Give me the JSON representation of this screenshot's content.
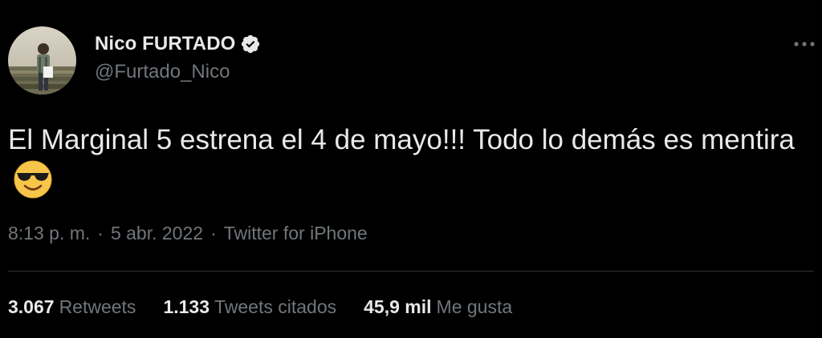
{
  "author": {
    "display_name": "Nico FURTADO",
    "handle": "@Furtado_Nico",
    "verified_icon": "verified-badge-icon",
    "avatar_icon": "profile-photo"
  },
  "menu": {
    "icon": "more-horizontal-icon"
  },
  "tweet": {
    "text": "El Marginal 5 estrena el 4 de mayo!!! Todo lo demás es mentira",
    "emoji": "smiling-face-with-sunglasses"
  },
  "meta": {
    "time": "8:13 p. m.",
    "separator": "·",
    "date": "5 abr. 2022",
    "source": "Twitter for iPhone"
  },
  "stats": {
    "retweets": {
      "count": "3.067",
      "label": "Retweets"
    },
    "quotes": {
      "count": "1.133",
      "label": "Tweets citados"
    },
    "likes": {
      "count": "45,9 mil",
      "label": "Me gusta"
    }
  },
  "colors": {
    "background": "#000000",
    "primary_text": "#e7e9ea",
    "secondary_text": "#71767b",
    "divider": "#2f3336"
  }
}
